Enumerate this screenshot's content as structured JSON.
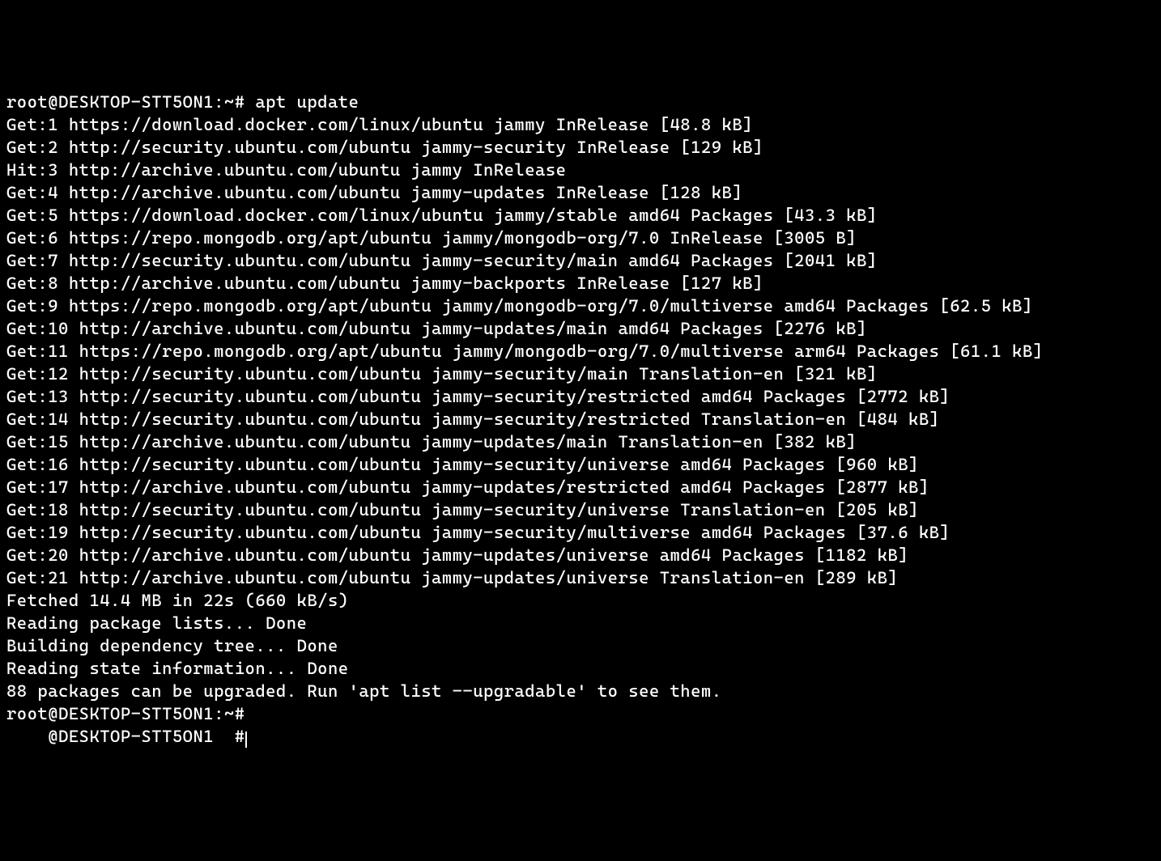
{
  "terminal": {
    "prompt1": "root@DESKTOP-STT5ON1:~#",
    "command1": " apt update",
    "lines": [
      "Get:1 https://download.docker.com/linux/ubuntu jammy InRelease [48.8 kB]",
      "Get:2 http://security.ubuntu.com/ubuntu jammy-security InRelease [129 kB]",
      "Hit:3 http://archive.ubuntu.com/ubuntu jammy InRelease",
      "Get:4 http://archive.ubuntu.com/ubuntu jammy-updates InRelease [128 kB]",
      "Get:5 https://download.docker.com/linux/ubuntu jammy/stable amd64 Packages [43.3 kB]",
      "Get:6 https://repo.mongodb.org/apt/ubuntu jammy/mongodb-org/7.0 InRelease [3005 B]",
      "Get:7 http://security.ubuntu.com/ubuntu jammy-security/main amd64 Packages [2041 kB]",
      "Get:8 http://archive.ubuntu.com/ubuntu jammy-backports InRelease [127 kB]",
      "Get:9 https://repo.mongodb.org/apt/ubuntu jammy/mongodb-org/7.0/multiverse amd64 Packages [62.5 kB]",
      "Get:10 http://archive.ubuntu.com/ubuntu jammy-updates/main amd64 Packages [2276 kB]",
      "Get:11 https://repo.mongodb.org/apt/ubuntu jammy/mongodb-org/7.0/multiverse arm64 Packages [61.1 kB]",
      "Get:12 http://security.ubuntu.com/ubuntu jammy-security/main Translation-en [321 kB]",
      "Get:13 http://security.ubuntu.com/ubuntu jammy-security/restricted amd64 Packages [2772 kB]",
      "Get:14 http://security.ubuntu.com/ubuntu jammy-security/restricted Translation-en [484 kB]",
      "Get:15 http://archive.ubuntu.com/ubuntu jammy-updates/main Translation-en [382 kB]",
      "Get:16 http://security.ubuntu.com/ubuntu jammy-security/universe amd64 Packages [960 kB]",
      "Get:17 http://archive.ubuntu.com/ubuntu jammy-updates/restricted amd64 Packages [2877 kB]",
      "Get:18 http://security.ubuntu.com/ubuntu jammy-security/universe Translation-en [205 kB]",
      "Get:19 http://security.ubuntu.com/ubuntu jammy-security/multiverse amd64 Packages [37.6 kB]",
      "Get:20 http://archive.ubuntu.com/ubuntu jammy-updates/universe amd64 Packages [1182 kB]",
      "Get:21 http://archive.ubuntu.com/ubuntu jammy-updates/universe Translation-en [289 kB]",
      "Fetched 14.4 MB in 22s (660 kB/s)",
      "Reading package lists... Done",
      "Building dependency tree... Done",
      "Reading state information... Done",
      "88 packages can be upgraded. Run 'apt list --upgradable' to see them."
    ],
    "prompt2": "root@DESKTOP-STT5ON1:~#",
    "command2": " ",
    "prompt3_partial": "    @DESKTOP-STT5ON1  #"
  }
}
